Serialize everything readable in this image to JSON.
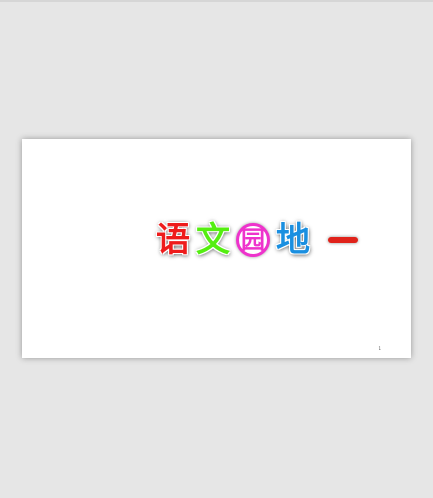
{
  "title": {
    "chars": [
      "语",
      "文",
      "园",
      "地",
      "一"
    ],
    "colors": [
      "#ee1c1c",
      "#55ee11",
      "#ee33cc",
      "#1a8fe0",
      "#e0221a"
    ]
  },
  "page_number": "1"
}
